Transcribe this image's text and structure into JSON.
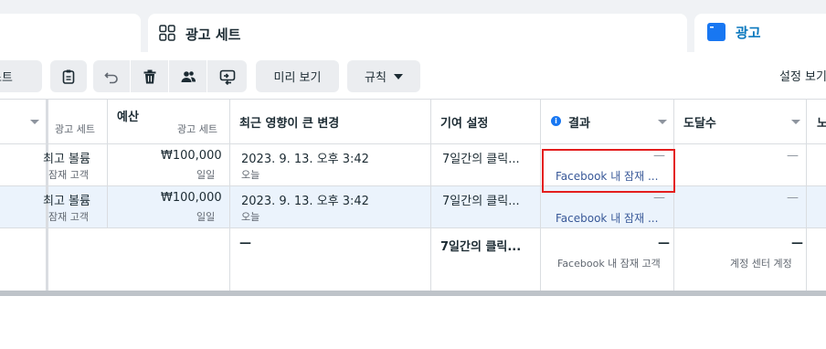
{
  "tabs": [
    {
      "label": ""
    },
    {
      "label": "광고 세트"
    },
    {
      "label": "광고"
    }
  ],
  "toolbar": {
    "list_label": "스트",
    "preview_label": "미리 보기",
    "rules_label": "규칙",
    "settings_view_label": "설정 보기"
  },
  "table": {
    "headers": {
      "adset_partial": "광고 세트",
      "budget": "예산",
      "budget_sub": "광고 세트",
      "recent_changes": "최근 영향이 큰 변경",
      "attribution": "기여 설정",
      "results": "결과",
      "reach": "도달수",
      "impressions_partial": "노"
    },
    "rows": [
      {
        "bid_strategy": "최고 볼륨",
        "bid_sub": "잠재 고객",
        "budget": "₩100,000",
        "budget_sub": "일일",
        "change": "2023. 9. 13. 오후 3:42",
        "change_sub": "오늘",
        "attribution": "7일간의 클릭...",
        "results": "—",
        "results_sub": "Facebook 내 잠재 ...",
        "reach": "—"
      },
      {
        "bid_strategy": "최고 볼륨",
        "bid_sub": "잠재 고객",
        "budget": "₩100,000",
        "budget_sub": "일일",
        "change": "2023. 9. 13. 오후 3:42",
        "change_sub": "오늘",
        "attribution": "7일간의 클릭...",
        "results": "—",
        "results_sub": "Facebook 내 잠재 ...",
        "reach": "—"
      }
    ],
    "totals": {
      "change": "—",
      "attribution": "7일간의 클릭...",
      "results": "—",
      "results_sub": "Facebook 내 잠재 고객",
      "reach": "—",
      "reach_sub": "계정 센터 계정"
    }
  },
  "colors": {
    "accent": "#1877f2",
    "highlight_row": "#ebf3fc",
    "red_box": "#e41e1e"
  }
}
